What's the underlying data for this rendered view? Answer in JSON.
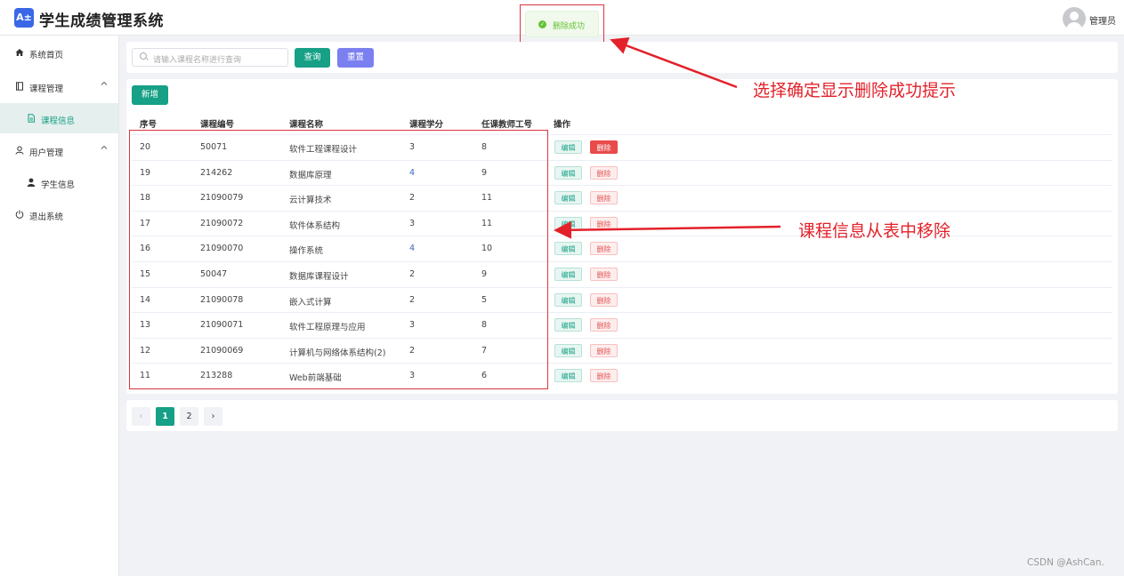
{
  "header": {
    "logo_text": "A±",
    "app_title": "学生成绩管理系统",
    "user_name": "管理员"
  },
  "toast": {
    "message": "删除成功",
    "icon": "check-circle-icon"
  },
  "sidebar": {
    "items": [
      {
        "label": "系统首页",
        "icon": "home-icon"
      },
      {
        "label": "课程管理",
        "icon": "book-icon",
        "expanded": true
      },
      {
        "label": "课程信息",
        "icon": "document-icon",
        "active": true
      },
      {
        "label": "用户管理",
        "icon": "user-icon",
        "expanded": true
      },
      {
        "label": "学生信息",
        "icon": "user-filled-icon"
      },
      {
        "label": "退出系统",
        "icon": "power-icon"
      }
    ]
  },
  "search": {
    "placeholder": "请输入课程名称进行查询",
    "query_label": "查询",
    "reset_label": "重置"
  },
  "toolbar": {
    "add_label": "新增"
  },
  "table": {
    "columns": [
      "序号",
      "课程编号",
      "课程名称",
      "课程学分",
      "任课教师工号",
      "操作"
    ],
    "edit_label": "编辑",
    "delete_label": "删除",
    "rows": [
      {
        "id": "20",
        "code": "50071",
        "name": "软件工程课程设计",
        "credit": "3",
        "teacher": "8"
      },
      {
        "id": "19",
        "code": "214262",
        "name": "数据库原理",
        "credit": "4",
        "teacher": "9"
      },
      {
        "id": "18",
        "code": "21090079",
        "name": "云计算技术",
        "credit": "2",
        "teacher": "11"
      },
      {
        "id": "17",
        "code": "21090072",
        "name": "软件体系结构",
        "credit": "3",
        "teacher": "11"
      },
      {
        "id": "16",
        "code": "21090070",
        "name": "操作系统",
        "credit": "4",
        "teacher": "10"
      },
      {
        "id": "15",
        "code": "50047",
        "name": "数据库课程设计",
        "credit": "2",
        "teacher": "9"
      },
      {
        "id": "14",
        "code": "21090078",
        "name": "嵌入式计算",
        "credit": "2",
        "teacher": "5"
      },
      {
        "id": "13",
        "code": "21090071",
        "name": "软件工程原理与应用",
        "credit": "3",
        "teacher": "8"
      },
      {
        "id": "12",
        "code": "21090069",
        "name": "计算机与网络体系结构(2)",
        "credit": "2",
        "teacher": "7"
      },
      {
        "id": "11",
        "code": "213288",
        "name": "Web前端基础",
        "credit": "3",
        "teacher": "6"
      }
    ]
  },
  "pagination": {
    "prev": "‹",
    "pages": [
      "1",
      "2"
    ],
    "current": "1",
    "next": "›"
  },
  "annotations": {
    "toast_note": "选择确定显示删除成功提示",
    "table_note": "课程信息从表中移除",
    "color": "#e3212a"
  },
  "watermark": "CSDN @AshCan.",
  "colors": {
    "primary": "#16a086",
    "reset": "#7b80f0",
    "danger": "#e94b4b",
    "accent": "#3a67e8"
  }
}
